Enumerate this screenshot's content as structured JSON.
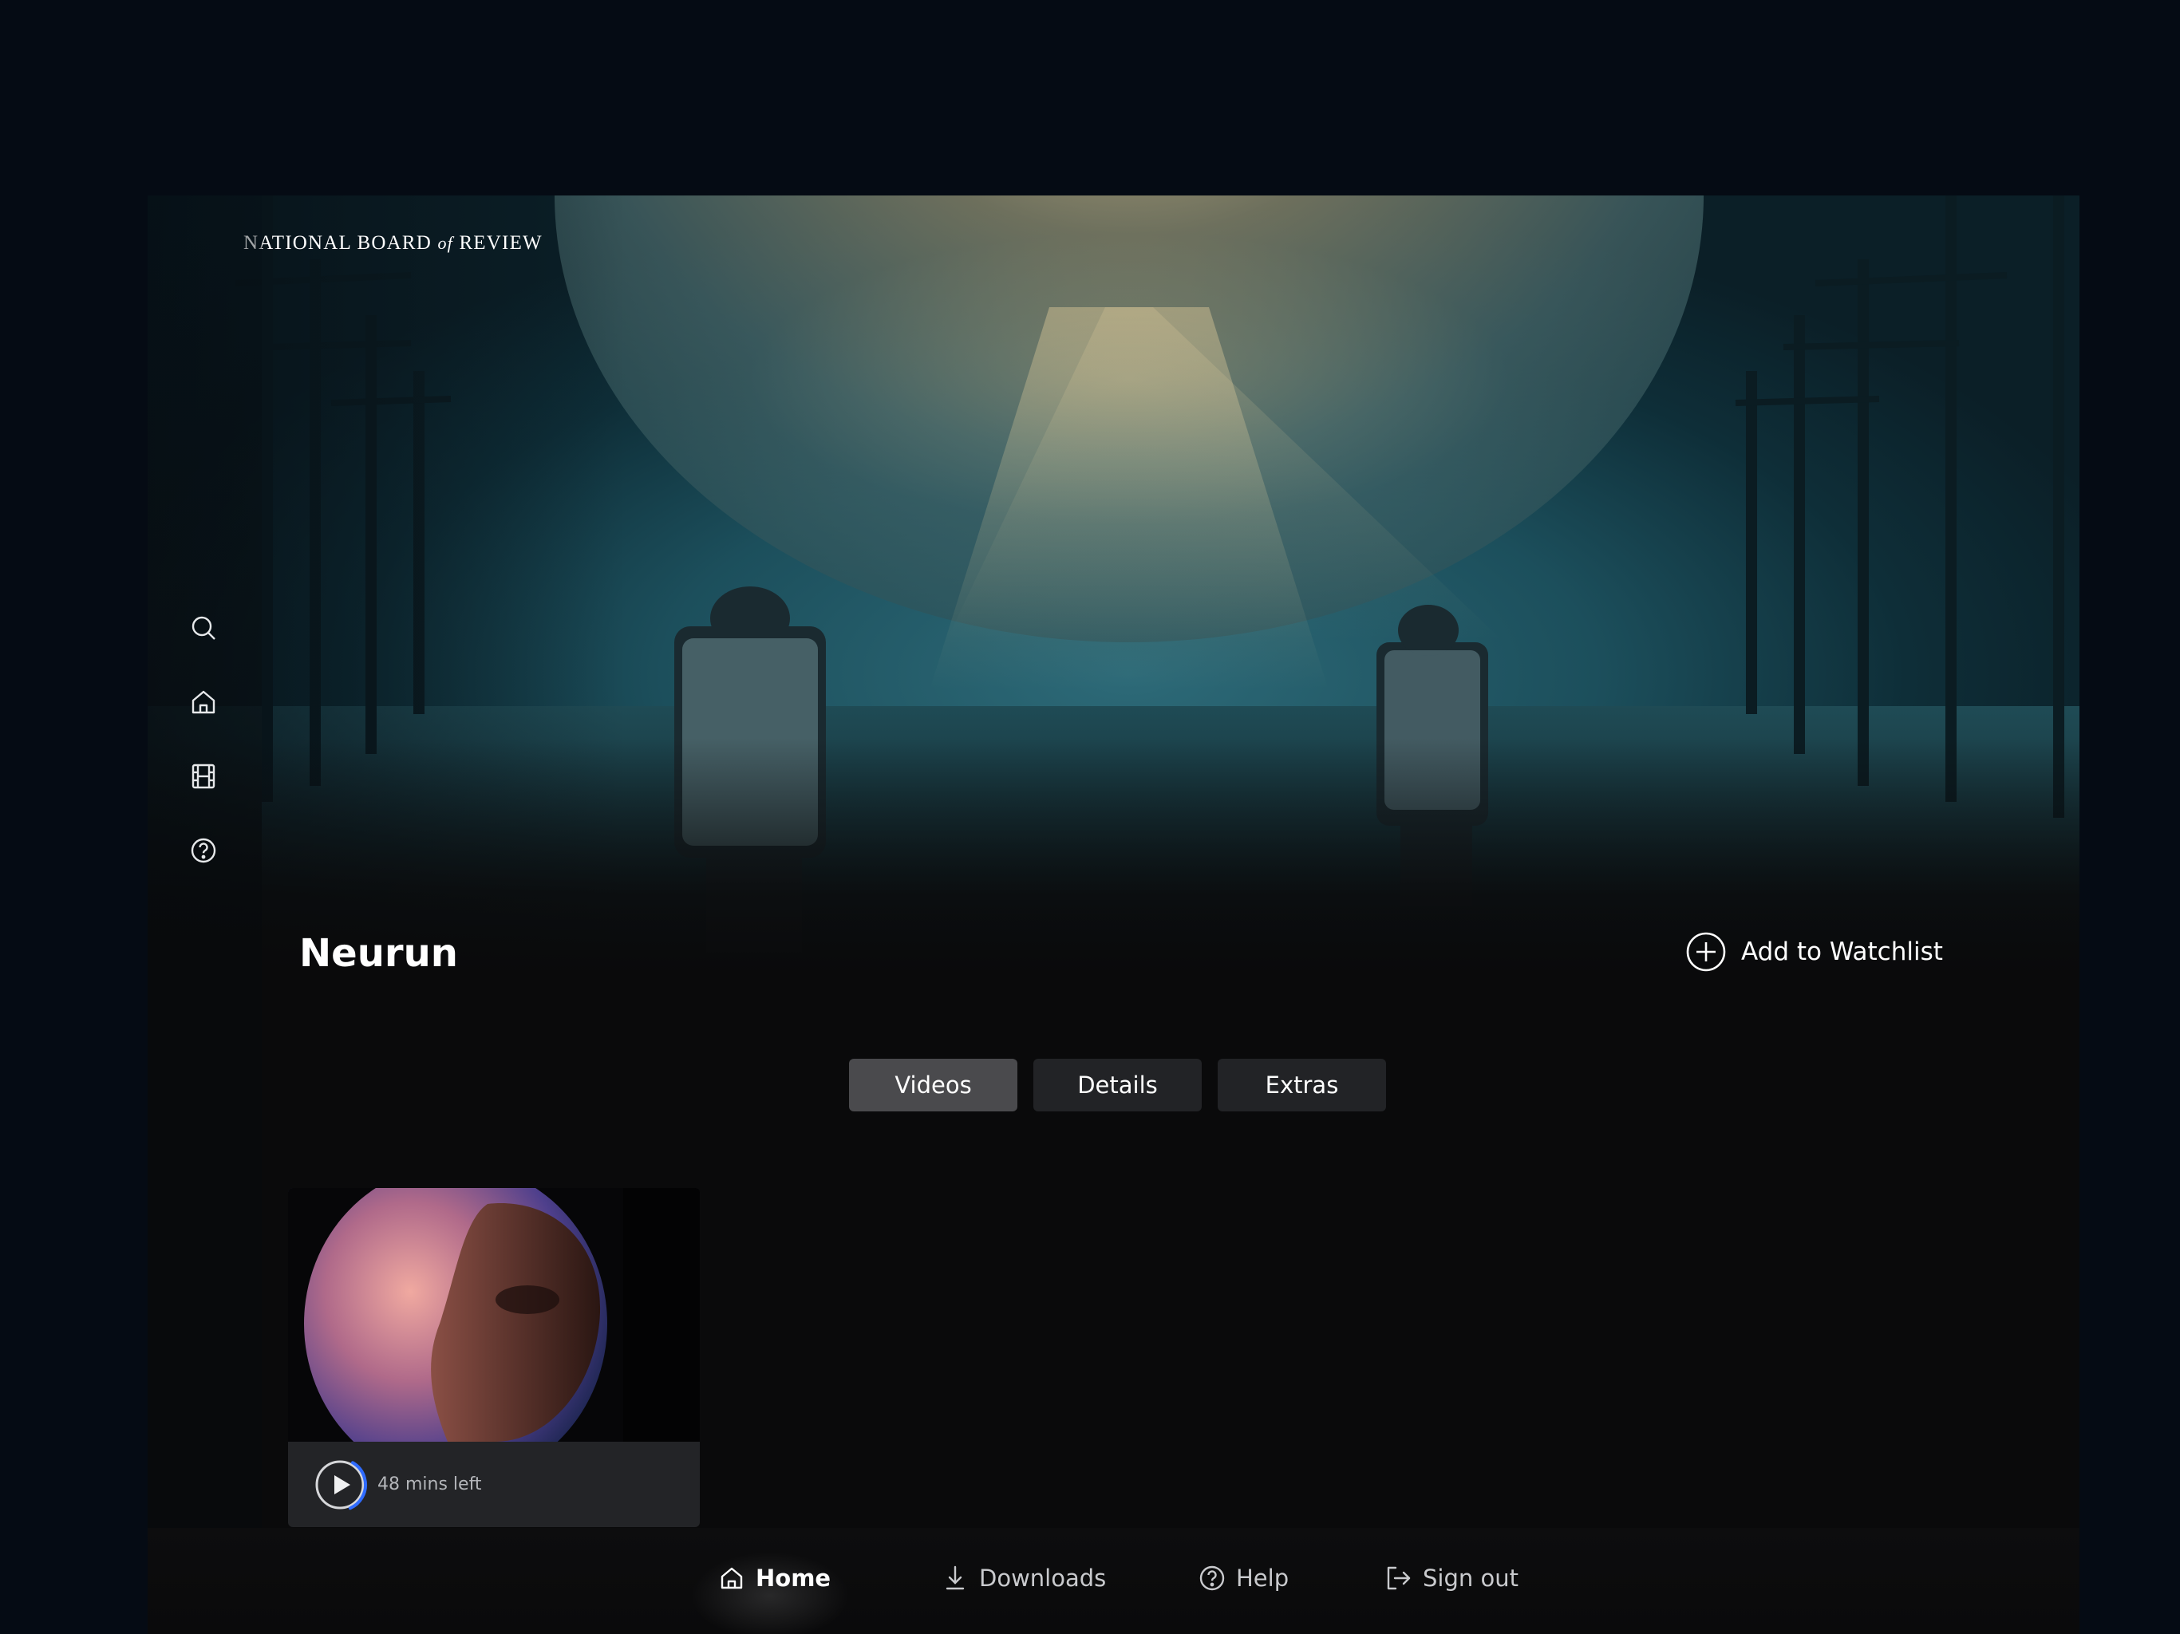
{
  "brand": {
    "logo_main": "NATIONAL BOARD",
    "logo_italic": "of",
    "logo_end": "REVIEW"
  },
  "sidebar": {
    "icons": [
      "search-icon",
      "home-icon",
      "film-icon",
      "help-icon"
    ]
  },
  "movie": {
    "title": "Neurun",
    "watchlist_label": "Add to Watchlist"
  },
  "tabs": [
    {
      "label": "Videos",
      "active": true
    },
    {
      "label": "Details",
      "active": false
    },
    {
      "label": "Extras",
      "active": false
    }
  ],
  "video_card": {
    "time_left": "48 mins left",
    "progress_fraction": 0.35
  },
  "bottom_nav": {
    "items": [
      {
        "label": "Home",
        "icon": "home-icon",
        "active": true
      },
      {
        "label": "Downloads",
        "icon": "download-icon",
        "active": false
      },
      {
        "label": "Help",
        "icon": "help-icon",
        "active": false
      },
      {
        "label": "Sign out",
        "icon": "sign-out-icon",
        "active": false
      }
    ]
  },
  "colors": {
    "background": "#050b14",
    "panel": "#0a0a0b",
    "tab_active": "#4a4a4d",
    "tab_inactive": "#222326",
    "progress_accent": "#2f6bff"
  }
}
